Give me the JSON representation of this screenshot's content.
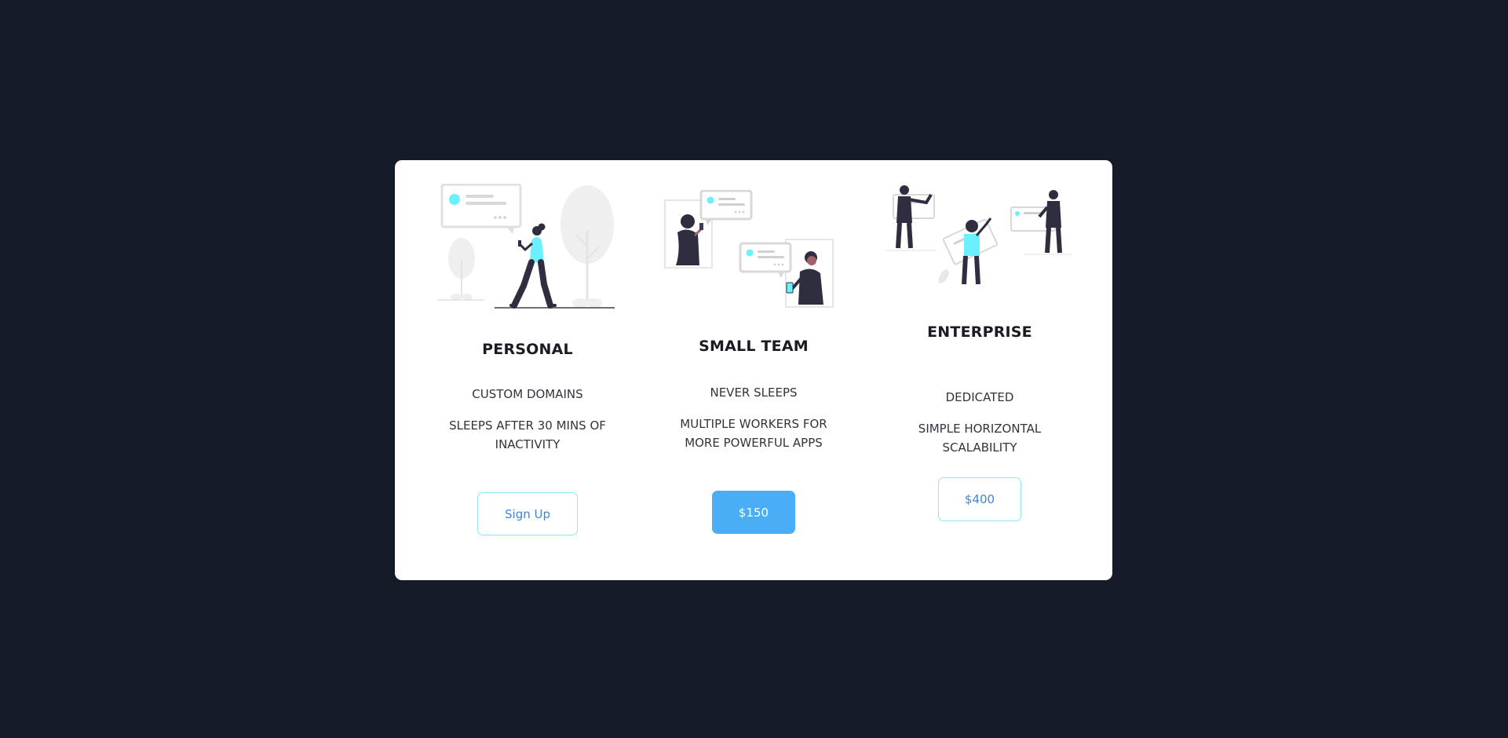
{
  "colors": {
    "background": "#161b2a",
    "card": "#ffffff",
    "accent": "#6af0ff",
    "primary_button": "#4aaef6",
    "outline_button_border": "#8be8f4",
    "outline_button_text": "#3f86de",
    "figure_dark": "#2f2e41"
  },
  "plans": [
    {
      "illustration": "person-texting-illustration",
      "title": "PERSONAL",
      "features": [
        "CUSTOM DOMAINS",
        "SLEEPS AFTER 30 MINS OF INACTIVITY"
      ],
      "button_label": "Sign Up"
    },
    {
      "illustration": "team-messaging-illustration",
      "title": "SMALL TEAM",
      "features": [
        "NEVER SLEEPS",
        "MULTIPLE WORKERS FOR MORE POWERFUL APPS"
      ],
      "button_label": "$150"
    },
    {
      "illustration": "enterprise-collaboration-illustration",
      "title": "ENTERPRISE",
      "features": [
        "DEDICATED",
        "SIMPLE HORIZONTAL SCALABILITY"
      ],
      "button_label": "$400"
    }
  ]
}
